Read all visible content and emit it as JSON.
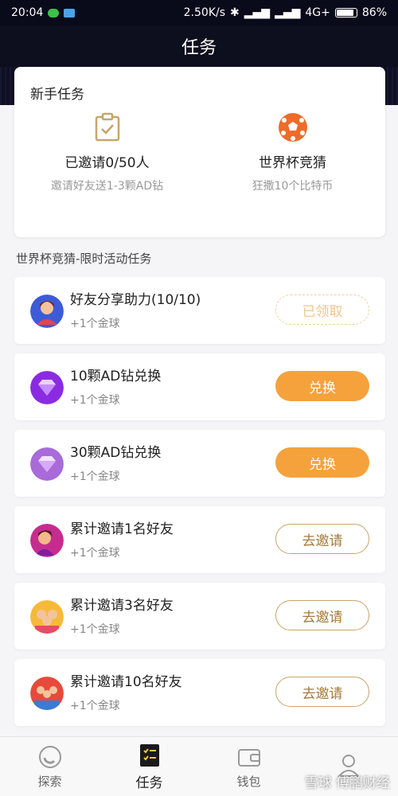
{
  "status": {
    "time": "20:04",
    "speed": "2.50K/s",
    "network": "4G+",
    "battery": "86%",
    "battery_level": 0.86
  },
  "page_title": "任务",
  "newbie": {
    "heading": "新手任务",
    "items": [
      {
        "main": "已邀请0/50人",
        "sub": "邀请好友送1-3颗AD钻",
        "icon": "clipboard-check-icon"
      },
      {
        "main": "世界杯竞猜",
        "sub": "狂撒10个比特币",
        "icon": "soccer-ball-icon"
      }
    ]
  },
  "section_title": "世界杯竞猜-限时活动任务",
  "tasks": [
    {
      "name": "好友分享助力(10/10)",
      "reward": "+1个金球",
      "button": "已领取",
      "state": "claimed"
    },
    {
      "name": "10颗AD钻兑换",
      "reward": "+1个金球",
      "button": "兑换",
      "state": "exchange"
    },
    {
      "name": "30颗AD钻兑换",
      "reward": "+1个金球",
      "button": "兑换",
      "state": "exchange"
    },
    {
      "name": "累计邀请1名好友",
      "reward": "+1个金球",
      "button": "去邀请",
      "state": "invite"
    },
    {
      "name": "累计邀请3名好友",
      "reward": "+1个金球",
      "button": "去邀请",
      "state": "invite"
    },
    {
      "name": "累计邀请10名好友",
      "reward": "+1个金球",
      "button": "去邀请",
      "state": "invite"
    }
  ],
  "tabs": [
    {
      "label": "探索",
      "icon": "explore-icon"
    },
    {
      "label": "任务",
      "icon": "task-list-icon",
      "active": true
    },
    {
      "label": "钱包",
      "icon": "wallet-icon"
    },
    {
      "label": "",
      "icon": "profile-icon"
    }
  ],
  "watermark": "雪球 傅鹏财经",
  "colors": {
    "accent": "#f5a23c",
    "header": "#0d0e1e",
    "invite_border": "#c9a46a"
  }
}
